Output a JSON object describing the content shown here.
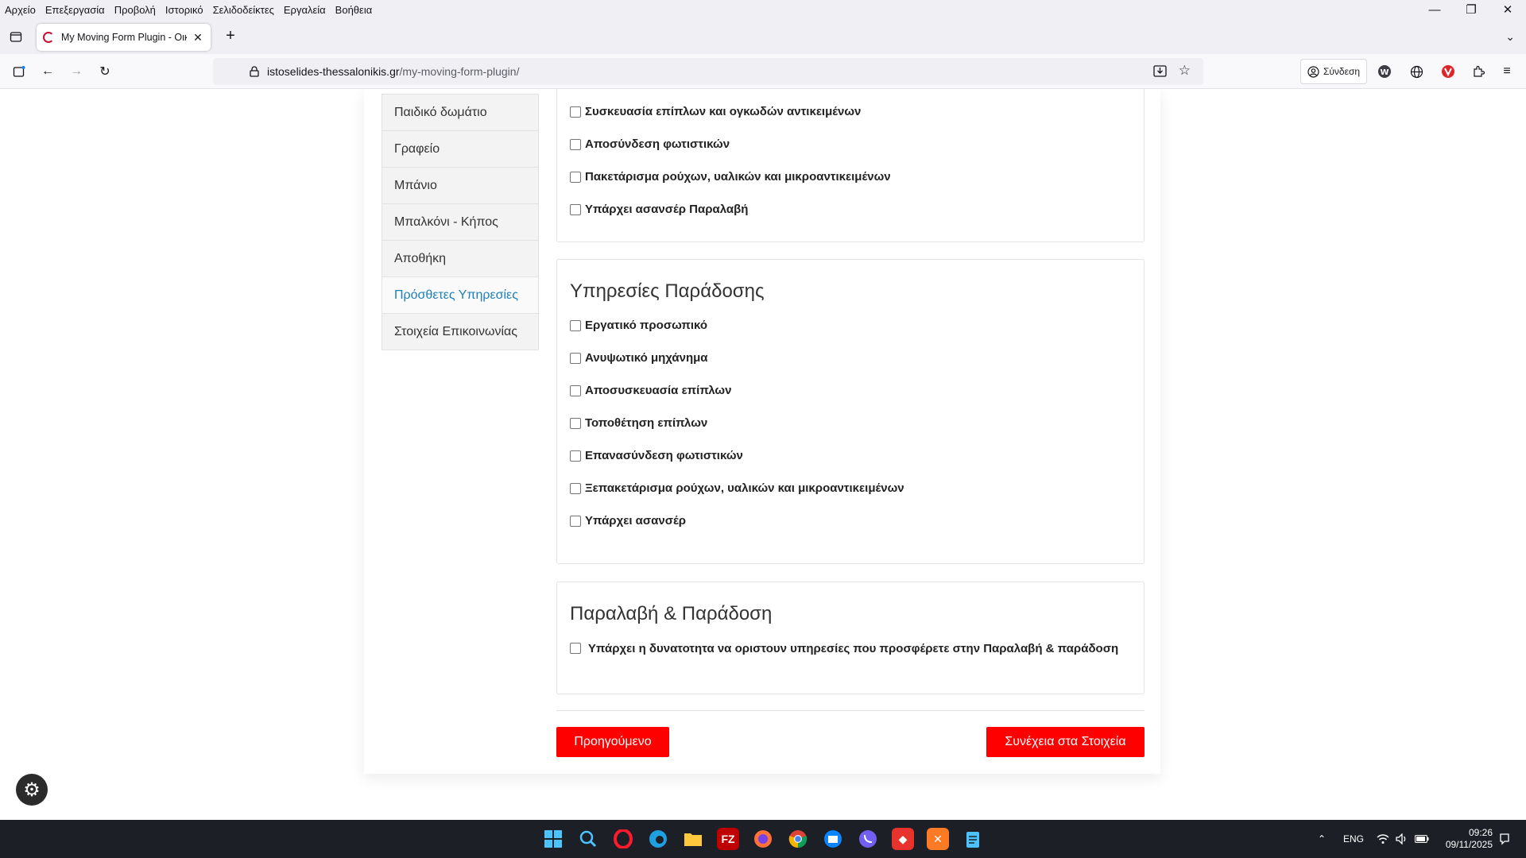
{
  "menubar": {
    "items": [
      "Αρχείο",
      "Επεξεργασία",
      "Προβολή",
      "Ιστορικό",
      "Σελιδοδείκτες",
      "Εργαλεία",
      "Βοήθεια"
    ]
  },
  "tab": {
    "title": "My Moving Form Plugin - Οικια",
    "close": "✕"
  },
  "navbar": {
    "url_host": "istoselides-thessalonikis.gr",
    "url_path": "/my-moving-form-plugin/",
    "signin_label": "Σύνδεση"
  },
  "sidebar": {
    "items": [
      {
        "label": "Παιδικό δωμάτιο"
      },
      {
        "label": "Γραφείο"
      },
      {
        "label": "Μπάνιο"
      },
      {
        "label": "Μπαλκόνι - Κήπος"
      },
      {
        "label": "Αποθήκη"
      },
      {
        "label": "Πρόσθετες Υπηρεσίες"
      },
      {
        "label": "Στοιχεία Επικοινωνίας"
      }
    ],
    "active_index": 5
  },
  "pickup_section": {
    "options": [
      "Συσκευασία επίπλων και ογκωδών αντικειμένων",
      "Αποσύνδεση φωτιστικών",
      "Πακετάρισμα ρούχων, υαλικών και μικροαντικειμένων",
      "Υπάρχει ασανσέρ Παραλαβή"
    ]
  },
  "delivery_section": {
    "title": "Υπηρεσίες Παράδοσης",
    "options": [
      "Εργατικό προσωπικό",
      "Ανυψωτικό μηχάνημα",
      "Αποσυσκευασία επίπλων",
      "Τοποθέτηση επίπλων",
      "Επανασύνδεση φωτιστικών",
      "Ξεπακετάρισμα ρούχων, υαλικών και μικροαντικειμένων",
      "Υπάρχει ασανσέρ"
    ]
  },
  "both_section": {
    "title": "Παραλαβή & Παράδοση",
    "option": "Υπάρχει η δυνατοτητα να οριστουν υπηρεσίες που προσφέρετε στην Παραλαβή & παράδοση"
  },
  "buttons": {
    "previous": "Προηγούμενο",
    "next": "Συνέχεια στα Στοιχεία"
  },
  "taskbar": {
    "language": "ENG",
    "time": "09:26",
    "date": "09/11/2025"
  },
  "colors": {
    "accent_red": "#ff0000",
    "active_link": "#1e7fb8"
  }
}
